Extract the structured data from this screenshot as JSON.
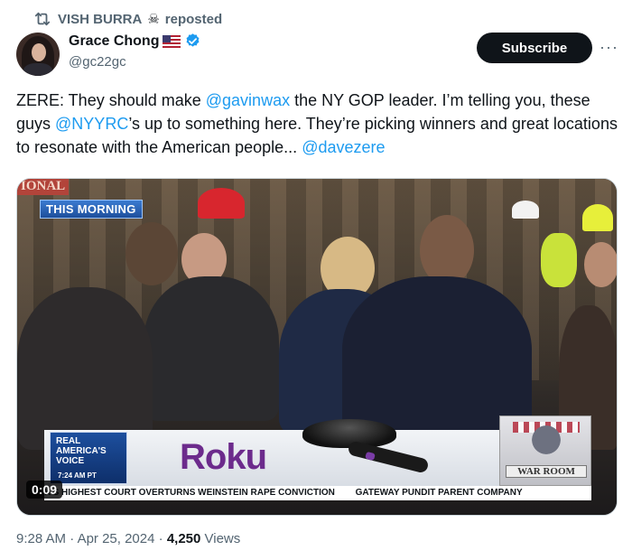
{
  "repost": {
    "icon": "repost-icon",
    "text": "VISH BURRA",
    "emoji": "☠",
    "suffix": "reposted"
  },
  "author": {
    "name": "Grace Chong",
    "handle": "@gc22gc",
    "flag": "us-flag-icon",
    "verified": "verified-badge-icon"
  },
  "actions": {
    "subscribe": "Subscribe",
    "more": "···"
  },
  "tweet": {
    "t1": "ZERE: They should make ",
    "m1": "@gavinwax",
    "t2": " the NY GOP leader. I’m telling you, these guys ",
    "m2": "@NYYRC",
    "t3": "’s up to something here. They’re picking winners and great locations to resonate with the American people... ",
    "m3": "@davezere"
  },
  "video": {
    "badge": "THIS MORNING",
    "corner_text": "IONAL",
    "ad": {
      "rav_line1": "REAL",
      "rav_line2": "AMERICA'S",
      "rav_line3": "VOICE",
      "rav_time": "7:24 AM PT",
      "brand": "Roku",
      "warroom": "WAR ROOM"
    },
    "ticker": [
      "K'S HIGHEST COURT OVERTURNS WEINSTEIN RAPE CONVICTION",
      "GATEWAY PUNDIT PARENT COMPANY"
    ],
    "duration": "0:09"
  },
  "meta": {
    "time": "9:28 AM",
    "sep1": " · ",
    "date": "Apr 25, 2024",
    "sep2": " · ",
    "views_count": "4,250",
    "views_label": " Views"
  },
  "colors": {
    "link": "#1d9bf0",
    "secondary": "#536471",
    "primary": "#0f1419"
  }
}
